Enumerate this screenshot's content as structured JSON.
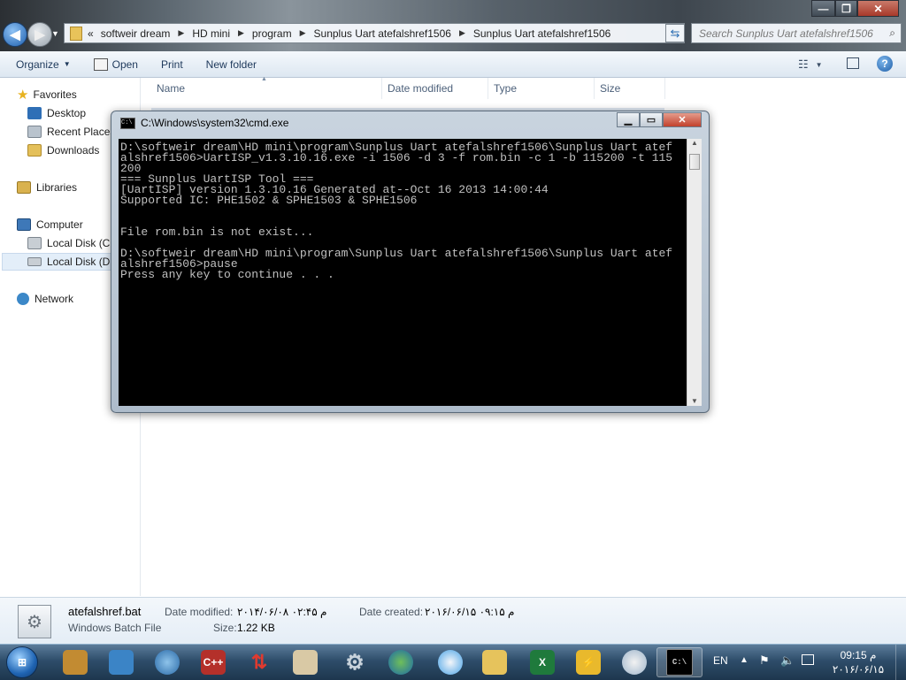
{
  "explorer": {
    "window_controls": {
      "minimize": "—",
      "maximize": "❐",
      "close": "✕"
    },
    "breadcrumb": {
      "overflow": "«",
      "segments": [
        "softweir dream",
        "HD mini",
        "program",
        "Sunplus Uart atefalshref1506",
        "Sunplus Uart atefalshref1506"
      ]
    },
    "search_placeholder": "Search Sunplus Uart atefalshref1506",
    "toolbar": {
      "organize": "Organize",
      "open": "Open",
      "print": "Print",
      "new_folder": "New folder"
    },
    "nav": {
      "favorites": "Favorites",
      "desktop": "Desktop",
      "recent_places": "Recent Places",
      "downloads": "Downloads",
      "libraries": "Libraries",
      "computer": "Computer",
      "local_disk_c": "Local Disk (C:)",
      "local_disk_d": "Local Disk (D:)",
      "network": "Network"
    },
    "columns": {
      "name": "Name",
      "date_modified": "Date modified",
      "type": "Type",
      "size": "Size"
    }
  },
  "details": {
    "file_name": "atefalshref.bat",
    "file_type": "Windows Batch File",
    "date_modified_label": "Date modified:",
    "date_modified_value": "۲۰۱۴/۰۶/۰۸ م ۰۲:۴۵",
    "size_label": "Size:",
    "size_value": "1.22 KB",
    "date_created_label": "Date created:",
    "date_created_value": "۲۰۱۶/۰۶/۱۵ م ۰۹:۱۵"
  },
  "cmd": {
    "title": "C:\\Windows\\system32\\cmd.exe",
    "output": "D:\\softweir dream\\HD mini\\program\\Sunplus Uart atefalshref1506\\Sunplus Uart atef\nalshref1506>UartISP_v1.3.10.16.exe -i 1506 -d 3 -f rom.bin -c 1 -b 115200 -t 115\n200\n=== Sunplus UartISP Tool ===\n[UartISP] version 1.3.10.16 Generated at--Oct 16 2013 14:00:44\nSupported IC: PHE1502 & SPHE1503 & SPHE1506\n\n\nFile rom.bin is not exist...\n\nD:\\softweir dream\\HD mini\\program\\Sunplus Uart atefalshref1506\\Sunplus Uart atef\nalshref1506>pause\nPress any key to continue . . ."
  },
  "taskbar": {
    "language": "EN",
    "time": "09:15 م",
    "date": "۲۰۱۶/۰۶/۱۵",
    "apps": [
      "start-orb",
      "app-hero",
      "app-media",
      "app-browser",
      "app-cpp",
      "app-transfer",
      "app-reader",
      "app-settings",
      "app-globe",
      "app-orb",
      "app-folder",
      "app-excel",
      "app-thunder",
      "app-paint",
      "app-cmd"
    ]
  },
  "colors": {
    "console_bg": "#000000",
    "console_text": "#c0c0c0",
    "toolbar_text": "#1e395b",
    "taskbar": "#2e4d6a"
  }
}
